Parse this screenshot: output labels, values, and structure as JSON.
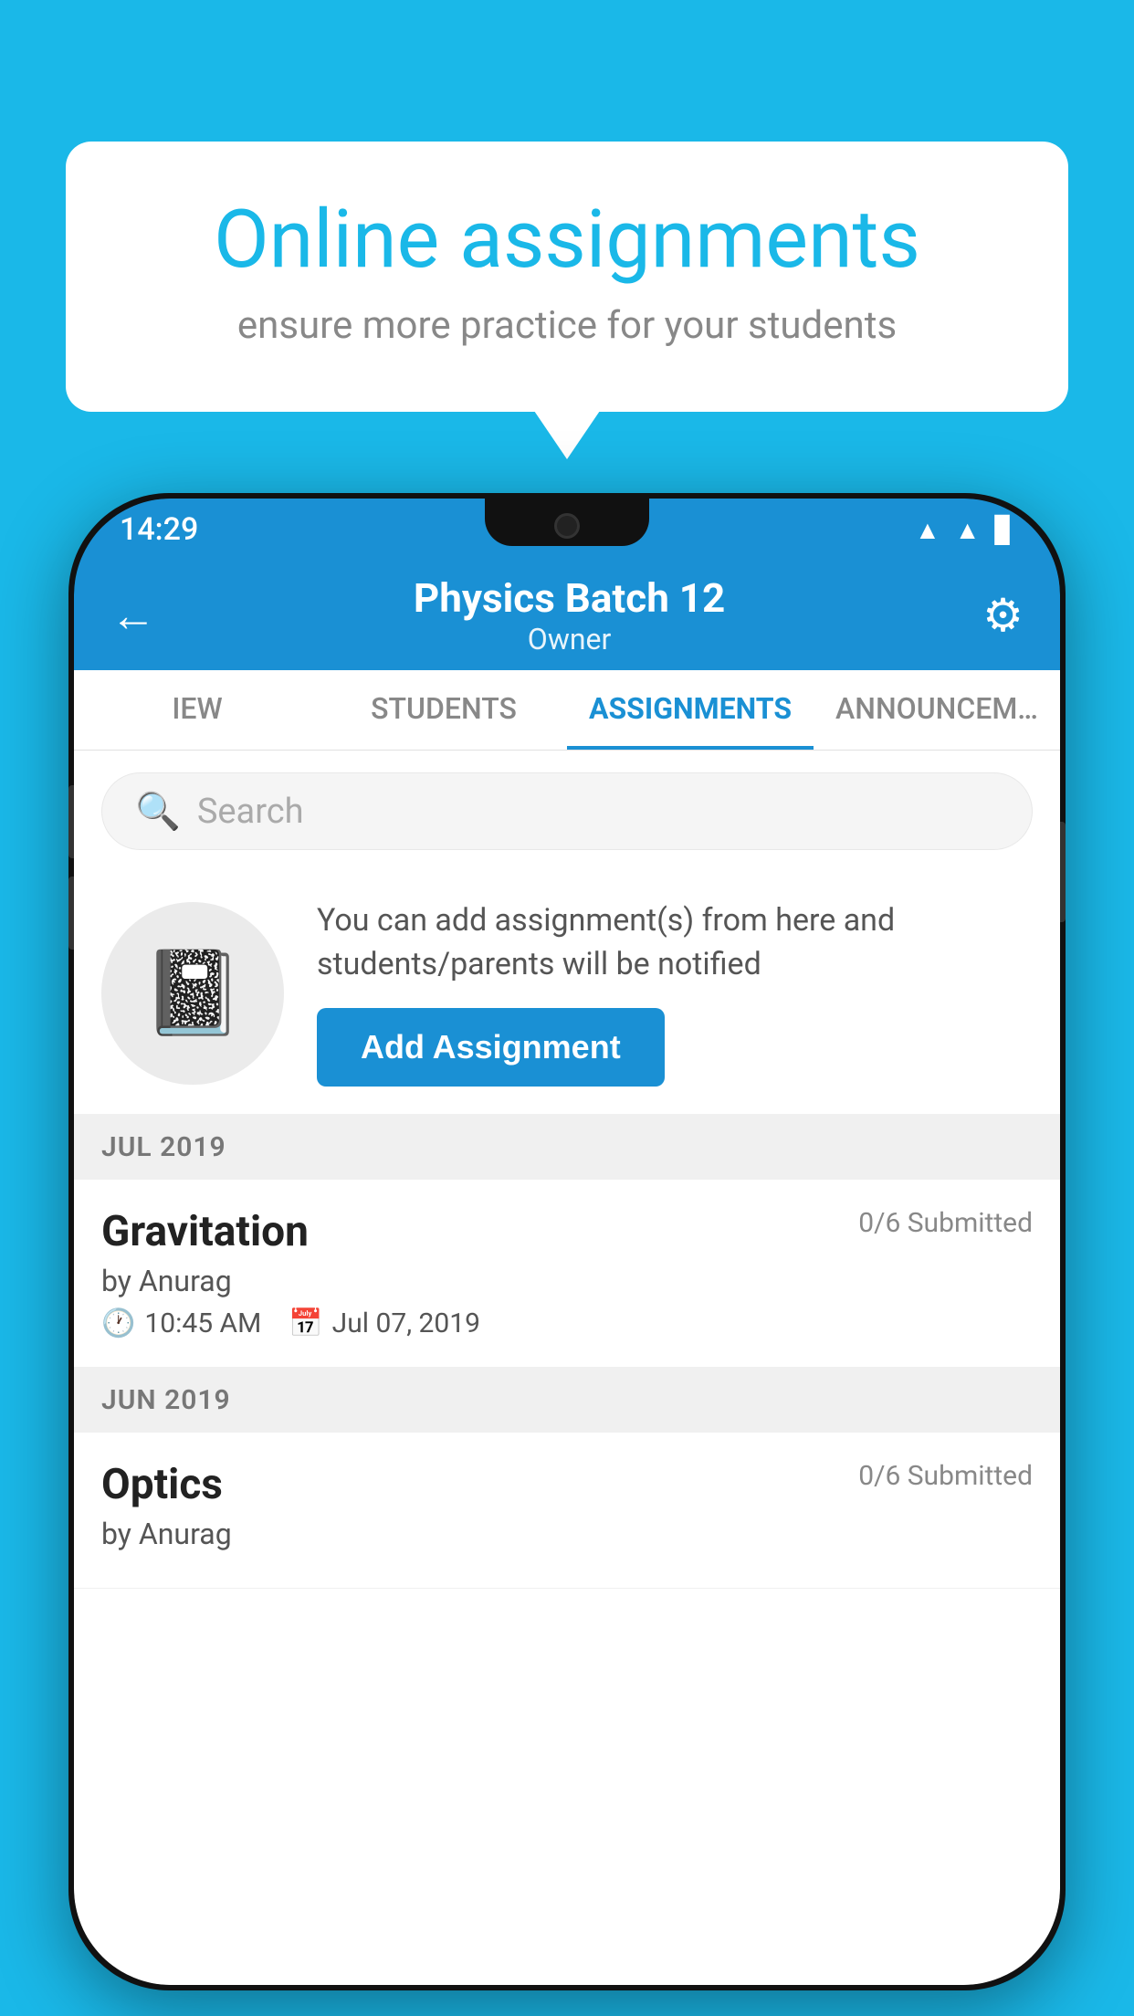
{
  "background_color": "#1ab8e8",
  "speech_bubble": {
    "title": "Online assignments",
    "subtitle": "ensure more practice for your students"
  },
  "phone": {
    "status_bar": {
      "time": "14:29",
      "icons": [
        "wifi",
        "signal",
        "battery"
      ]
    },
    "header": {
      "title": "Physics Batch 12",
      "subtitle": "Owner",
      "back_label": "←",
      "settings_label": "⚙"
    },
    "tabs": [
      {
        "label": "IEW",
        "active": false
      },
      {
        "label": "STUDENTS",
        "active": false
      },
      {
        "label": "ASSIGNMENTS",
        "active": true
      },
      {
        "label": "ANNOUNCEM…",
        "active": false
      }
    ],
    "search": {
      "placeholder": "Search"
    },
    "promo": {
      "description": "You can add assignment(s) from here and students/parents will be notified",
      "button_label": "Add Assignment"
    },
    "sections": [
      {
        "month": "JUL 2019",
        "assignments": [
          {
            "name": "Gravitation",
            "submitted": "0/6 Submitted",
            "author": "by Anurag",
            "time": "10:45 AM",
            "date": "Jul 07, 2019"
          }
        ]
      },
      {
        "month": "JUN 2019",
        "assignments": [
          {
            "name": "Optics",
            "submitted": "0/6 Submitted",
            "author": "by Anurag",
            "time": "",
            "date": ""
          }
        ]
      }
    ]
  }
}
